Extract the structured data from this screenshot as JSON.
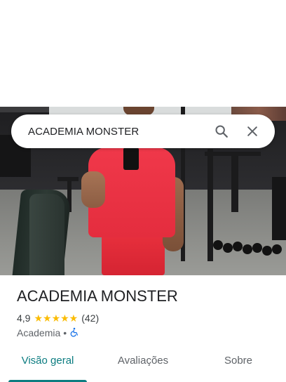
{
  "search": {
    "query": "ACADEMIA MONSTER"
  },
  "place": {
    "title": "ACADEMIA MONSTER",
    "rating": "4,9",
    "stars": "★★★★★",
    "reviews_count": "(42)",
    "category": "Academia",
    "separator": "•"
  },
  "tabs": [
    {
      "label": "Visão geral",
      "active": true
    },
    {
      "label": "Avaliações",
      "active": false
    },
    {
      "label": "Sobre",
      "active": false
    }
  ],
  "colors": {
    "accent": "#0b7c80",
    "star": "#fbbc04",
    "accessibility": "#1a73e8"
  },
  "icons": {
    "search": "search-icon",
    "close": "close-icon",
    "accessibility": "wheelchair-icon"
  }
}
